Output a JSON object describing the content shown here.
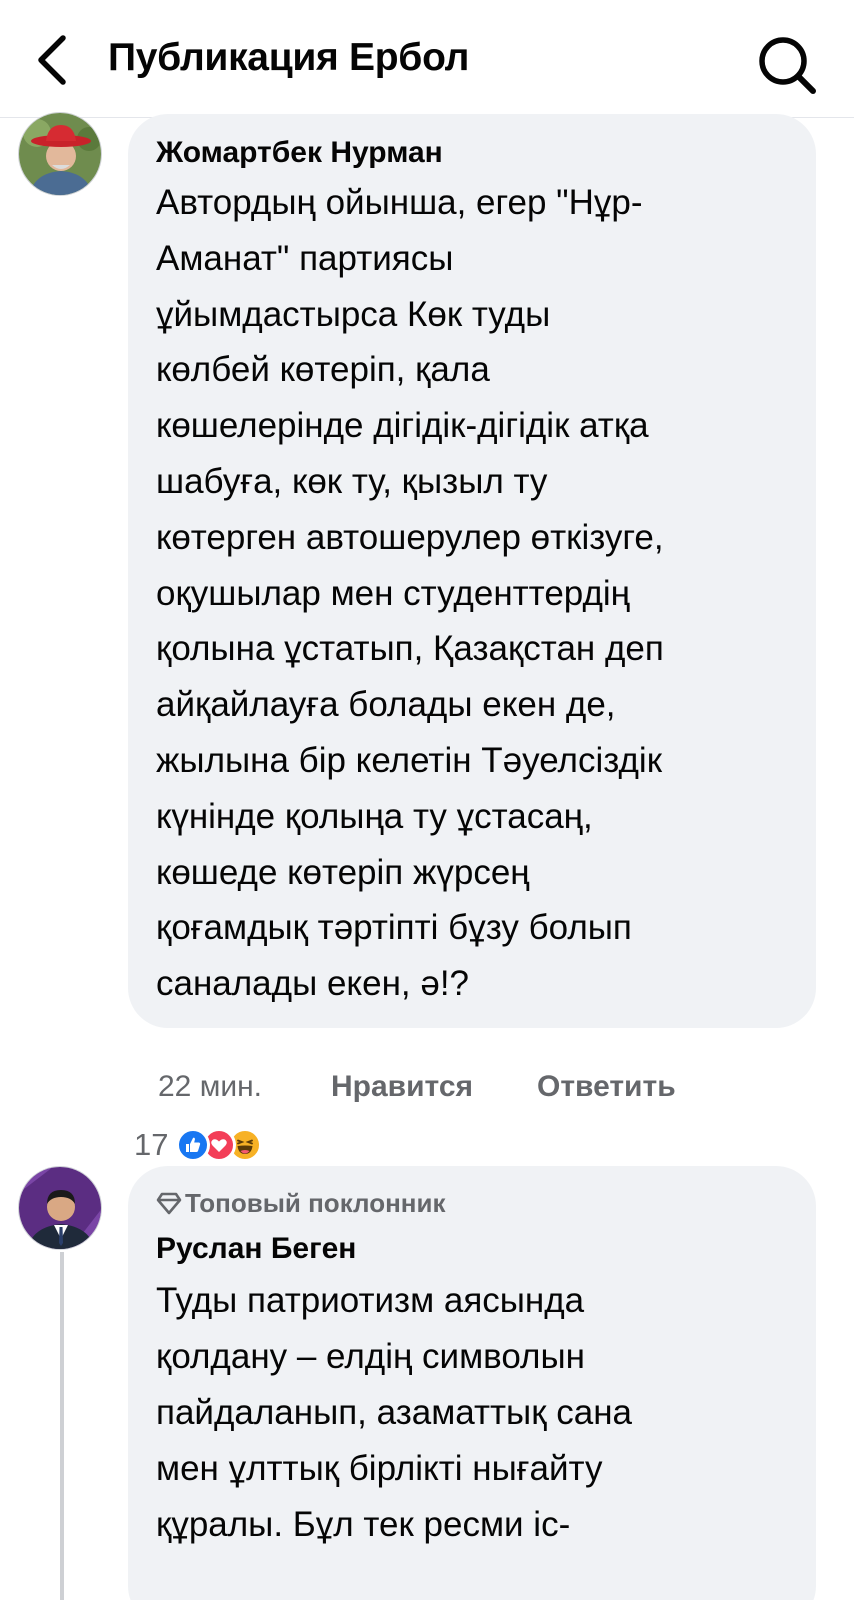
{
  "header": {
    "title": "Публикация Ербол"
  },
  "comments": [
    {
      "author": "Жомартбек Нурман",
      "lines": [
        "Автордың ойынша, егер \"Нұр-",
        "Аманат\" партиясы",
        "ұйымдастырса Көк туды",
        "көлбей көтеріп, қала",
        "көшелерінде дігідік-дігідік атқа",
        "шабуға, көк ту, қызыл ту",
        "көтерген автошерулер өткізуге,",
        "оқушылар мен студенттердің",
        "қолына ұстатып, Қазақстан деп",
        "айқайлауға болады екен де,",
        "жылына бір келетін Тәуелсіздік",
        "күнінде қолыңа ту ұстасаң,",
        "көшеде көтеріп жүрсең",
        "қоғамдық тәртіпті бұзу болып",
        "саналады екен, ә!?"
      ],
      "time": "22 мин.",
      "like_label": "Нравится",
      "reply_label": "Ответить",
      "reaction_count": "17",
      "reactions": [
        "like-icon",
        "love-icon",
        "haha-icon"
      ]
    },
    {
      "badge": "Топовый поклонник",
      "author": "Руслан Беген",
      "lines": [
        "Туды патриотизм аясында",
        "қолдану – елдің символын",
        "пайдаланып, азаматтық сана",
        "мен ұлттық бірлікті нығайту",
        "құралы. Бұл тек ресми іс-"
      ]
    }
  ],
  "colors": {
    "bubble": "#f0f2f5",
    "secondary_text": "#65676b",
    "like_blue": "#1877f2",
    "love_red": "#f33e58",
    "haha_yellow": "#f7b125"
  }
}
